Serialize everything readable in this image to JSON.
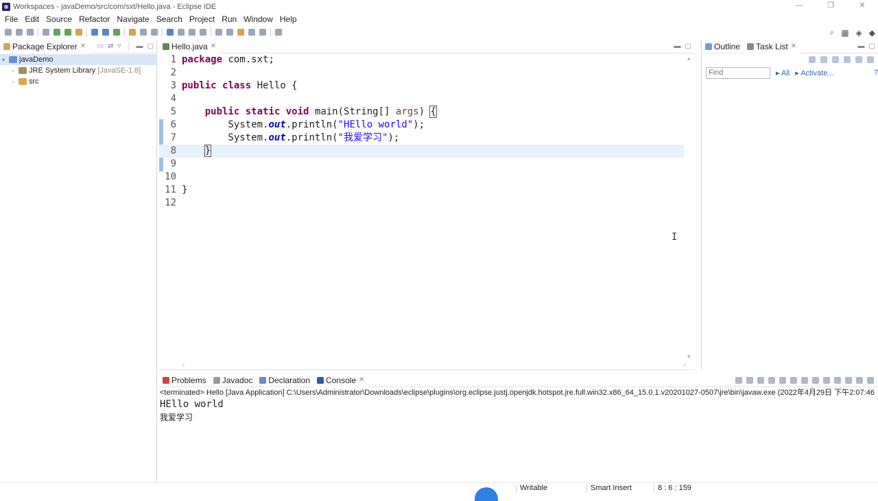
{
  "window": {
    "title": "Workspaces - javaDemo/src/com/sxt/Hello.java - Eclipse IDE",
    "controls": [
      "—",
      "❐",
      "✕"
    ]
  },
  "menu": [
    "File",
    "Edit",
    "Source",
    "Refactor",
    "Navigate",
    "Search",
    "Project",
    "Run",
    "Window",
    "Help"
  ],
  "package_explorer": {
    "tab_label": "Package Explorer",
    "project": "javaDemo",
    "jre_label": "JRE System Library",
    "jre_version": "[JavaSE-1.8]",
    "src_label": "src"
  },
  "editor": {
    "tab_label": "Hello.java",
    "line_numbers": [
      "1",
      "2",
      "3",
      "4",
      "5",
      "6",
      "7",
      "8",
      "9",
      "10",
      "11",
      "12"
    ]
  },
  "outline_panel": {
    "outline_label": "Outline",
    "task_list_label": "Task List",
    "find_placeholder": "Find",
    "all_label": "All",
    "activate_label": "Activate..."
  },
  "console_panel": {
    "tabs": [
      "Problems",
      "Javadoc",
      "Declaration",
      "Console"
    ],
    "terminated": "<terminated> Hello [Java Application] C:\\Users\\Administrator\\Downloads\\eclipse\\plugins\\org.eclipse.justj.openjdk.hotspot.jre.full.win32.x86_64_15.0.1.v20201027-0507\\jre\\bin\\javaw.exe  (2022年4月29日 下午2:07:46",
    "output": [
      "HEllo world",
      "我爱学习"
    ]
  },
  "status_bar": {
    "mode": "Writable",
    "insert": "Smart Insert",
    "position": "8 : 6 : 159"
  },
  "colors": {
    "keyword": "#7f0055",
    "string": "#2a00ff",
    "field": "#0000c0",
    "current_line": "#e8f2fe"
  }
}
